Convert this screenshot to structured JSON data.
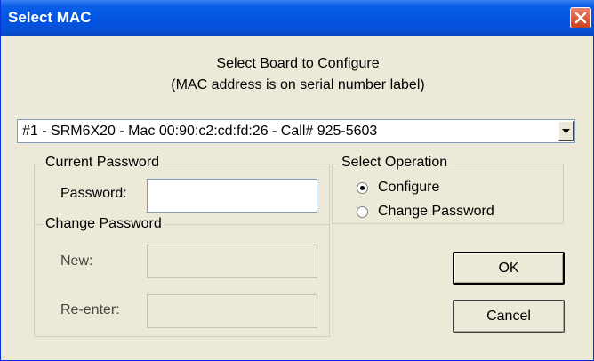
{
  "window": {
    "title": "Select MAC"
  },
  "heading": {
    "line1": "Select Board to Configure",
    "line2": "(MAC address is on serial number label)"
  },
  "board_select": {
    "value": "#1 - SRM6X20 - Mac 00:90:c2:cd:fd:26 - Call# 925-5603"
  },
  "current_password": {
    "legend": "Current Password",
    "password_label": "Password:",
    "password_value": ""
  },
  "change_password": {
    "legend": "Change Password",
    "new_label": "New:",
    "reenter_label": "Re-enter:"
  },
  "operation": {
    "legend": "Select Operation",
    "options": [
      {
        "label": "Configure",
        "selected": true
      },
      {
        "label": "Change Password",
        "selected": false
      }
    ]
  },
  "buttons": {
    "ok": "OK",
    "cancel": "Cancel"
  }
}
